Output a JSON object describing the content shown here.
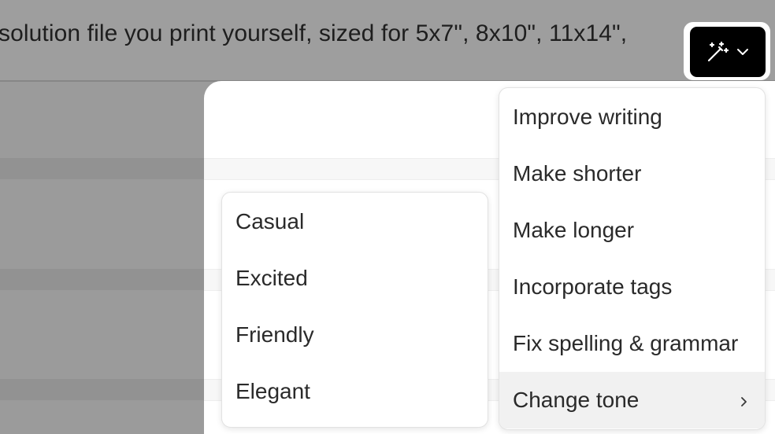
{
  "editor": {
    "text_line": "solution file you print yourself, sized for 5x7\", 8x10\", 11x14\","
  },
  "ai_button": {
    "icon": "magic-wand-icon",
    "dropdown_icon": "chevron-down-icon"
  },
  "main_menu": {
    "items": [
      {
        "label": "Improve writing"
      },
      {
        "label": "Make shorter"
      },
      {
        "label": "Make longer"
      },
      {
        "label": "Incorporate tags"
      },
      {
        "label": "Fix spelling & grammar"
      },
      {
        "label": "Change tone",
        "has_submenu": true,
        "active": true
      }
    ]
  },
  "tone_menu": {
    "items": [
      {
        "label": "Casual"
      },
      {
        "label": "Excited"
      },
      {
        "label": "Friendly"
      },
      {
        "label": "Elegant"
      }
    ]
  },
  "colors": {
    "overlay": "#9b9b9b",
    "button_bg": "#000000",
    "menu_bg": "#ffffff",
    "active_item_bg": "#f1f1f1",
    "text": "#2a2a2a"
  }
}
